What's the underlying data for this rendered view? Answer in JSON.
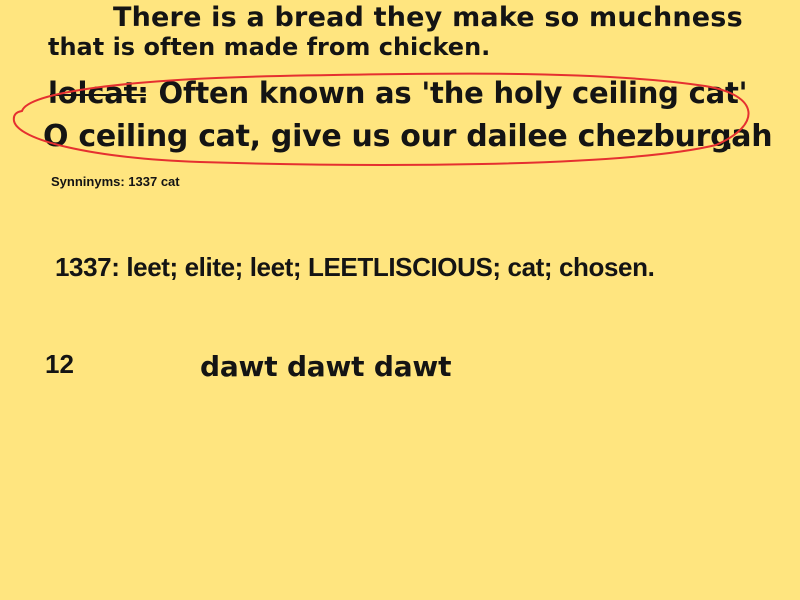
{
  "meme": {
    "line1": "There is a bread they make so muchness",
    "line2": "that is often made from chicken.",
    "line3": "lolcat: Often known as 'the holy ceiling cat'",
    "line4": "O ceiling cat, give us our dailee chezburgah",
    "line4_period": ".",
    "synonyms": "Synninyms: 1337 cat",
    "leet": "1337: leet; elite; leet; LEETLISCIOUS; cat; chosen.",
    "number": "12",
    "dawt": "dawt dawt dawt"
  },
  "colors": {
    "background": "#FFE57F",
    "text": "#141414",
    "oval": "#E53030"
  }
}
